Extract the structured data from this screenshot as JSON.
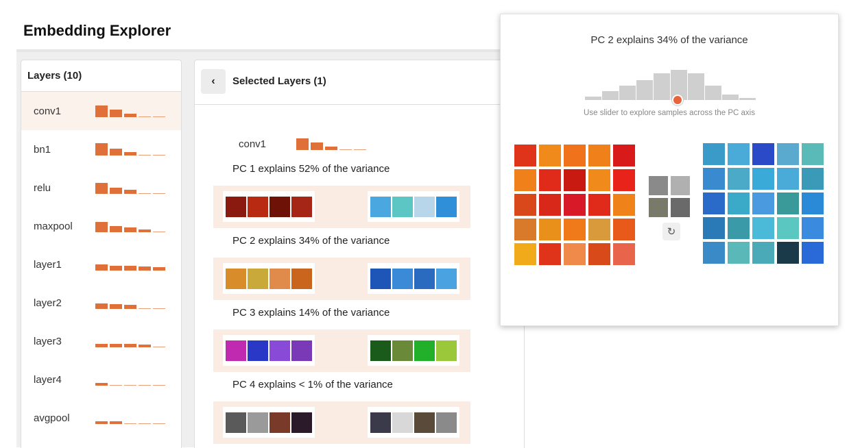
{
  "app": {
    "title": "Embedding Explorer"
  },
  "layers_panel": {
    "header": "Layers (10)",
    "items": [
      {
        "label": "conv1",
        "bars": [
          52,
          34,
          14,
          1,
          1
        ],
        "selected": true
      },
      {
        "label": "bn1",
        "bars": [
          54,
          30,
          14,
          1,
          1
        ],
        "selected": false
      },
      {
        "label": "relu",
        "bars": [
          48,
          28,
          18,
          1,
          1
        ],
        "selected": false
      },
      {
        "label": "maxpool",
        "bars": [
          44,
          26,
          20,
          12,
          1
        ],
        "selected": false
      },
      {
        "label": "layer1",
        "bars": [
          28,
          22,
          20,
          18,
          16
        ],
        "selected": false
      },
      {
        "label": "layer2",
        "bars": [
          24,
          22,
          18,
          1,
          1
        ],
        "selected": false
      },
      {
        "label": "layer3",
        "bars": [
          14,
          14,
          14,
          12,
          1
        ],
        "selected": false
      },
      {
        "label": "layer4",
        "bars": [
          12,
          1,
          1,
          1,
          1
        ],
        "selected": false
      },
      {
        "label": "avgpool",
        "bars": [
          12,
          12,
          1,
          1,
          1
        ],
        "selected": false
      }
    ]
  },
  "selected_panel": {
    "back_icon": "‹",
    "header": "Selected Layers (1)",
    "layer": {
      "label": "conv1",
      "bars": [
        52,
        34,
        14,
        1,
        1
      ]
    },
    "pcs": [
      {
        "title": "PC 1 explains 52% of the variance",
        "left": [
          "#8a1a10",
          "#b82a12",
          "#6e1208",
          "#a52616"
        ],
        "right": [
          "#4aa7e0",
          "#5cc6c4",
          "#b7d6ea",
          "#2f90d9"
        ]
      },
      {
        "title": "PC 2 explains 34% of the variance",
        "left": [
          "#d98c2a",
          "#c9a93a",
          "#e08b4c",
          "#c9651c"
        ],
        "right": [
          "#1e56b8",
          "#3a8ad8",
          "#2a6bc0",
          "#4aa2e0"
        ]
      },
      {
        "title": "PC 3 explains 14% of the variance",
        "left": [
          "#c02ab0",
          "#2a38c8",
          "#8a4ad8",
          "#7a3ab8"
        ],
        "right": [
          "#1a5a1a",
          "#6a8a3a",
          "#22b02a",
          "#9ac83a"
        ]
      },
      {
        "title": "PC 4 explains < 1% of the variance",
        "left": [
          "#5a5a5a",
          "#9a9a9a",
          "#7a3a2a",
          "#2a1a2a"
        ],
        "right": [
          "#3a3a4a",
          "#d8d8d8",
          "#5a4a3a",
          "#8a8a8a"
        ]
      }
    ]
  },
  "popup": {
    "title": "PC 2 explains 34% of the variance",
    "histogram": [
      4,
      10,
      16,
      22,
      30,
      34,
      30,
      16,
      6,
      2
    ],
    "slider_value": 0.54,
    "slider_hint": "Use slider to explore samples across the PC axis",
    "refresh_icon": "↻",
    "left_grid": [
      "#e0341a",
      "#f08a1a",
      "#f0721a",
      "#f0801a",
      "#d81a1a",
      "#f0801a",
      "#e02a1a",
      "#c81a10",
      "#f08a1a",
      "#e8241a",
      "#d8481a",
      "#d8281a",
      "#d81a28",
      "#e02a1a",
      "#f0821a",
      "#d87a2a",
      "#e8901a",
      "#f07a1a",
      "#d89a3a",
      "#e85a1a",
      "#f0aa1a",
      "#e0341a",
      "#f08a4a",
      "#d84a1a",
      "#e8644a"
    ],
    "mid_grid": [
      "#8a8a8a",
      "#b0b0b0",
      "#7a7a6a",
      "#6a6a6a"
    ],
    "right_grid": [
      "#3a9ac8",
      "#4aaad8",
      "#2a4ac8",
      "#5aaad0",
      "#5abab8",
      "#3a8ad0",
      "#4aaac8",
      "#3aaad8",
      "#4aaad8",
      "#3a9ab8",
      "#2a6ac8",
      "#3aaac8",
      "#4a9ae0",
      "#3a9a9a",
      "#2a8ad8",
      "#2a7ab8",
      "#3a9aa8",
      "#4abad8",
      "#5ac8c0",
      "#3a8ae0",
      "#3a8ac8",
      "#5ab8b8",
      "#4aaab8",
      "#1a3a4a",
      "#2a6ad8"
    ]
  }
}
